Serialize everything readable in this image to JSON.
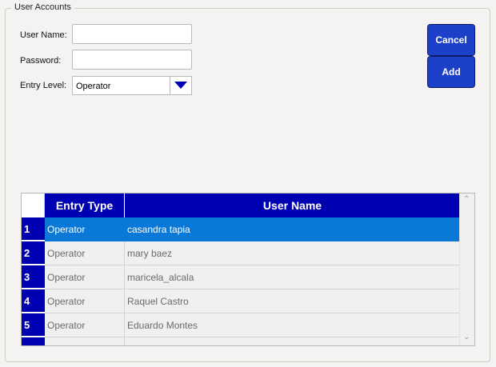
{
  "group": {
    "title": "User Accounts"
  },
  "form": {
    "username_label": "User Name:",
    "username_value": "",
    "password_label": "Password:",
    "password_value": "",
    "entry_level_label": "Entry Level:",
    "entry_level_value": "Operator"
  },
  "buttons": {
    "cancel": "Cancel",
    "add": "Add"
  },
  "colors": {
    "header_bg": "#0000b3",
    "button_bg": "#1d40c9",
    "selected_row": "#0a78d6"
  },
  "table": {
    "columns": [
      "Entry Type",
      "User Name"
    ],
    "rows": [
      {
        "num": "1",
        "entry_type": "Operator",
        "user_name": "casandra tapia",
        "selected": true
      },
      {
        "num": "2",
        "entry_type": "Operator",
        "user_name": "mary baez",
        "selected": false
      },
      {
        "num": "3",
        "entry_type": "Operator",
        "user_name": "maricela_alcala",
        "selected": false
      },
      {
        "num": "4",
        "entry_type": "Operator",
        "user_name": "Raquel Castro",
        "selected": false
      },
      {
        "num": "5",
        "entry_type": "Operator",
        "user_name": "Eduardo Montes",
        "selected": false
      },
      {
        "num": "",
        "entry_type": "",
        "user_name": "",
        "selected": false
      }
    ]
  }
}
